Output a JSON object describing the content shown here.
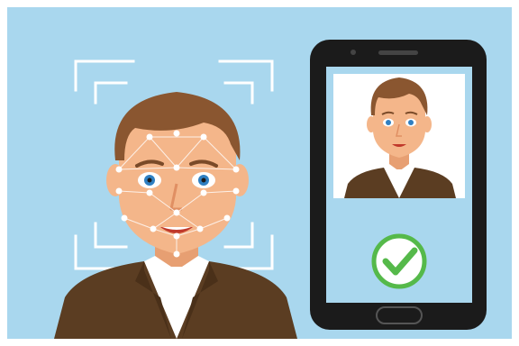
{
  "illustration": {
    "subject": "face-recognition-verification",
    "icons": [
      "face-scan-frame-icon",
      "smartphone-icon",
      "checkmark-icon"
    ],
    "colors": {
      "background": "#a9d7ee",
      "hair": "#8a5630",
      "skin": "#f4b68a",
      "suit": "#5b3d22",
      "shirt": "#ffffff",
      "phone_body": "#1b1b1b",
      "phone_screen": "#a9d7ee",
      "check": "#55b94a"
    }
  }
}
